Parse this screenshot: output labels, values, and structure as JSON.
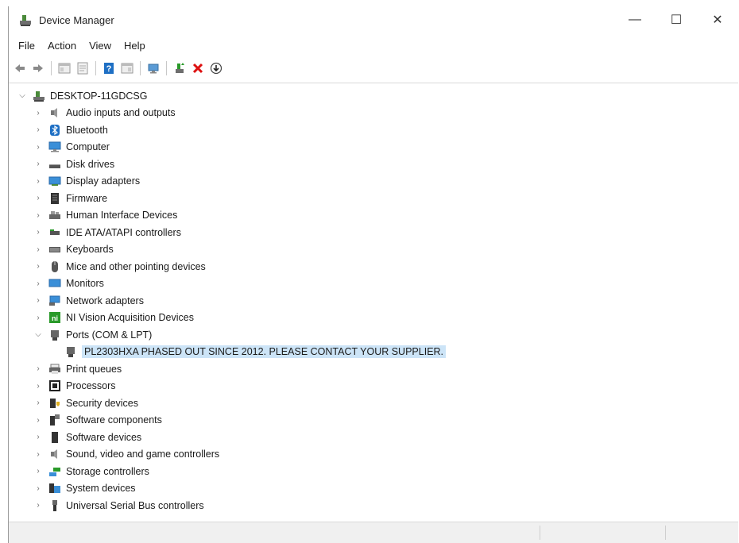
{
  "window": {
    "title": "Device Manager",
    "controls": {
      "minimize": "—",
      "maximize": "☐",
      "close": "✕"
    }
  },
  "menu": [
    "File",
    "Action",
    "View",
    "Help"
  ],
  "toolbar": [
    {
      "icon": "back-arrow-icon"
    },
    {
      "icon": "forward-arrow-icon"
    },
    {
      "icon": "show-hide-console-tree-icon"
    },
    {
      "icon": "properties-icon"
    },
    {
      "icon": "help-icon"
    },
    {
      "icon": "action-pane-icon"
    },
    {
      "icon": "scan-hardware-icon"
    },
    {
      "icon": "update-driver-icon"
    },
    {
      "icon": "uninstall-device-icon"
    },
    {
      "icon": "download-driver-icon"
    }
  ],
  "tree": {
    "root": "DESKTOP-11GDCSG",
    "categories": [
      {
        "label": "Audio inputs and outputs",
        "icon": "speaker-icon",
        "expanded": false
      },
      {
        "label": "Bluetooth",
        "icon": "bluetooth-icon",
        "expanded": false
      },
      {
        "label": "Computer",
        "icon": "computer-icon",
        "expanded": false
      },
      {
        "label": "Disk drives",
        "icon": "disk-drive-icon",
        "expanded": false
      },
      {
        "label": "Display adapters",
        "icon": "display-adapter-icon",
        "expanded": false
      },
      {
        "label": "Firmware",
        "icon": "firmware-icon",
        "expanded": false
      },
      {
        "label": "Human Interface Devices",
        "icon": "hid-icon",
        "expanded": false
      },
      {
        "label": "IDE ATA/ATAPI controllers",
        "icon": "ide-controller-icon",
        "expanded": false
      },
      {
        "label": "Keyboards",
        "icon": "keyboard-icon",
        "expanded": false
      },
      {
        "label": "Mice and other pointing devices",
        "icon": "mouse-icon",
        "expanded": false
      },
      {
        "label": "Monitors",
        "icon": "monitor-icon",
        "expanded": false
      },
      {
        "label": "Network adapters",
        "icon": "network-adapter-icon",
        "expanded": false
      },
      {
        "label": "NI Vision Acquisition Devices",
        "icon": "ni-vision-icon",
        "expanded": false
      },
      {
        "label": "Ports (COM & LPT)",
        "icon": "port-icon",
        "expanded": true,
        "children": [
          {
            "label": "PL2303HXA PHASED OUT SINCE 2012. PLEASE CONTACT YOUR SUPPLIER.",
            "icon": "port-icon"
          }
        ]
      },
      {
        "label": "Print queues",
        "icon": "printer-icon",
        "expanded": false
      },
      {
        "label": "Processors",
        "icon": "processor-icon",
        "expanded": false
      },
      {
        "label": "Security devices",
        "icon": "security-device-icon",
        "expanded": false
      },
      {
        "label": "Software components",
        "icon": "software-component-icon",
        "expanded": false
      },
      {
        "label": "Software devices",
        "icon": "software-device-icon",
        "expanded": false
      },
      {
        "label": "Sound, video and game controllers",
        "icon": "sound-controller-icon",
        "expanded": false
      },
      {
        "label": "Storage controllers",
        "icon": "storage-controller-icon",
        "expanded": false
      },
      {
        "label": "System devices",
        "icon": "system-devices-icon",
        "expanded": false
      },
      {
        "label": "Universal Serial Bus controllers",
        "icon": "usb-icon",
        "expanded": false
      }
    ]
  },
  "colors": {
    "selection": "#cce4f7",
    "accent_blue": "#1e6fc4",
    "uninstall_red": "#d11",
    "scan_green": "#2a9a2a"
  }
}
